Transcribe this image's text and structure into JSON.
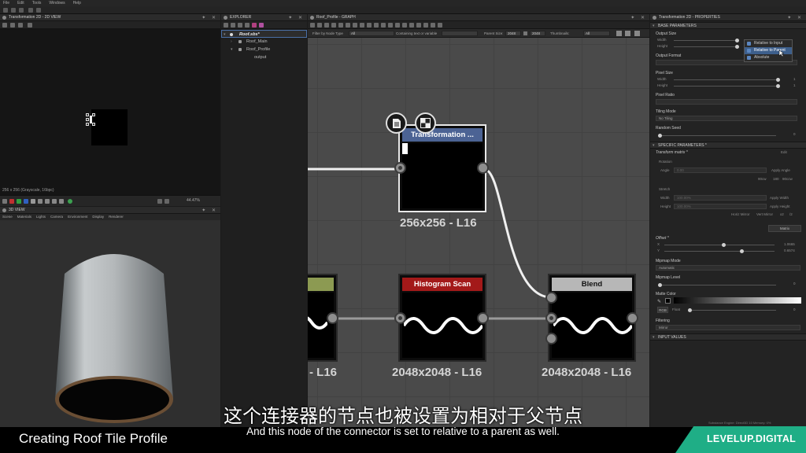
{
  "menu": [
    "File",
    "Edit",
    "Tools",
    "Windows",
    "Help"
  ],
  "view2d": {
    "title": "Transformation 2D - 2D VIEW",
    "status": "256 x 256 (Grayscale, 16bpc)",
    "zoom": "44.47%"
  },
  "view3d": {
    "title": "3D VIEW",
    "tabs": [
      "Scene",
      "Materials",
      "Lights",
      "Camera",
      "Environment",
      "Display",
      "Renderer"
    ]
  },
  "explorer": {
    "title": "EXPLORER",
    "items": [
      {
        "label": "Roof.sbs*",
        "selected": true
      },
      {
        "label": "Roof_Main"
      },
      {
        "label": "Roof_Profile"
      },
      {
        "label": "output"
      }
    ]
  },
  "graph": {
    "title": "Roof_Profile - GRAPH",
    "filter": {
      "by_type_label": "Filter by Node Type",
      "by_type_value": "All",
      "containing_label": "Containing text or variable",
      "parent_size_label": "Parent Size:",
      "parent_w": "2048",
      "parent_h": "2048",
      "thumbnails_label": "Thumbnails:",
      "thumbnails_value": "All"
    },
    "nodes": [
      {
        "id": "transformation",
        "title": "Transformation ...",
        "size_label": "256x256 - L16",
        "color": "#4c6394"
      },
      {
        "id": "left",
        "title": "",
        "size_label": "- L16",
        "color": "#8c9a52"
      },
      {
        "id": "histogram",
        "title": "Histogram Scan",
        "size_label": "2048x2048 - L16",
        "color": "#a31919"
      },
      {
        "id": "blend",
        "title": "Blend",
        "size_label": "2048x2048 - L16",
        "color": "#b7b7b7"
      }
    ]
  },
  "properties": {
    "title": "Transformation 2D - PROPERTIES",
    "base_section": "BASE PARAMETERS",
    "output_size": {
      "label": "Output Size",
      "width": "Width",
      "height": "Height"
    },
    "size_menu": {
      "options": [
        "Relative to Input",
        "Relative to Parent",
        "Absolute"
      ],
      "active": "Relative to Parent"
    },
    "output_format": "Output Format",
    "pixel_size": {
      "label": "Pixel Size",
      "width": "Width",
      "height": "Height",
      "w_val": "1",
      "h_val": "1"
    },
    "pixel_ratio": "Pixel Ratio",
    "tiling_mode": {
      "label": "Tiling Mode",
      "value": "No Tiling"
    },
    "random_seed": {
      "label": "Random Seed",
      "value": "0"
    },
    "specific_section": "SPECIFIC PARAMETERS *",
    "transform_matrix": {
      "label": "Transform matrix *",
      "edit": "Edit"
    },
    "rotation": {
      "label": "Rotation",
      "angle_label": "Angle",
      "angle_value": "0.00",
      "apply": "Apply Angle",
      "cw90": "90cw",
      "r180": "180",
      "ccw90": "90ccw"
    },
    "stretch": {
      "label": "Stretch",
      "width_label": "Width",
      "width_value": "100.00%",
      "height_label": "Height",
      "height_value": "100.00%",
      "apply_w": "Apply Width",
      "apply_h": "Apply Height",
      "hmirror": "Horiz Mirror",
      "vmirror": "Vert Mirror",
      "x2": "x2",
      "d2": "/2"
    },
    "matrix_btn": "Matrix",
    "offset": {
      "label": "Offset *",
      "x_label": "X",
      "y_label": "Y",
      "x": "1.0665",
      "y": "0.6574"
    },
    "mipmap_mode": {
      "label": "Mipmap Mode",
      "value": "Automatic"
    },
    "mipmap_level": {
      "label": "Mipmap Level",
      "value": "0"
    },
    "matte_color": {
      "label": "Matte Color",
      "mode": "RGB",
      "type": "Float",
      "value": "0"
    },
    "filtering": {
      "label": "Filtering",
      "value": "Mirror"
    },
    "input_section": "INPUT VALUES"
  },
  "overlay": {
    "caption_cn": "这个连接器的节点也被设置为相对于父节点",
    "caption_en": "And this node of the connector is set to relative to a parent as well.",
    "video_title": "Creating Roof Tile Profile",
    "brand": "LEVELUP.DIGITAL",
    "engine": "Substance Engine: Direct3D 10   Memory: 0%"
  }
}
